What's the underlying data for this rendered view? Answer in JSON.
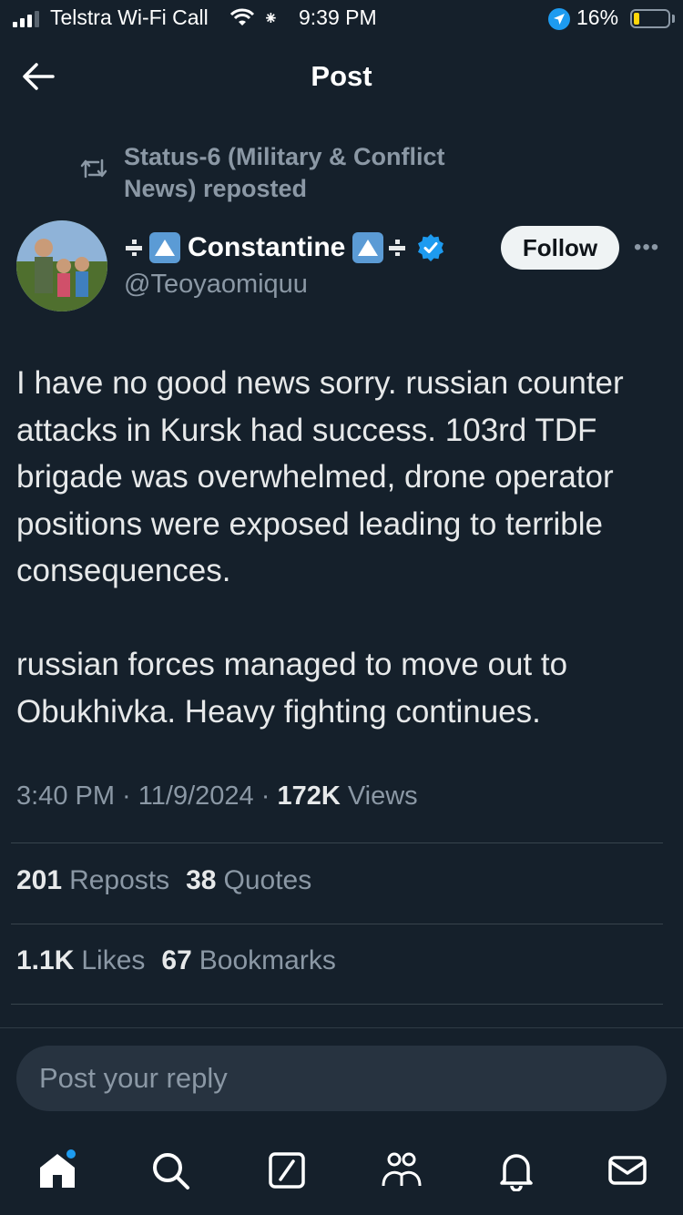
{
  "status_bar": {
    "carrier": "Telstra Wi-Fi Call",
    "time": "9:39 PM",
    "battery_pct": "16%",
    "battery_level": 0.16
  },
  "header": {
    "title": "Post"
  },
  "repost": {
    "label": "Status-6 (Military & Conflict News) reposted"
  },
  "author": {
    "name": "Constantine",
    "handle": "@Teoyaomiquu",
    "follow_label": "Follow",
    "more_label": "•••"
  },
  "post": {
    "text": "I have no good news sorry. russian counter attacks in Kursk had success. 103rd TDF brigade was overwhelmed, drone operator positions were exposed leading to terrible consequences.\n\nrussian forces managed to move out to Obukhivka. Heavy fighting continues.",
    "time": "3:40 PM",
    "sep1": " · ",
    "date": "11/9/2024",
    "sep2": " · ",
    "views_count": "172K",
    "views_label": "Views"
  },
  "stats": {
    "reposts_count": "201",
    "reposts_label": "Reposts",
    "quotes_count": "38",
    "quotes_label": "Quotes",
    "likes_count": "1.1K",
    "likes_label": "Likes",
    "bookmarks_count": "67",
    "bookmarks_label": "Bookmarks"
  },
  "reply": {
    "placeholder": "Post your reply"
  },
  "tabs": [
    "home-icon",
    "search-icon",
    "grok-icon",
    "communities-icon",
    "notifications-icon",
    "messages-icon"
  ],
  "colors": {
    "background": "#15202b",
    "accent": "#1d9bf0",
    "muted": "#8b98a5",
    "text": "#e7e9ea"
  }
}
